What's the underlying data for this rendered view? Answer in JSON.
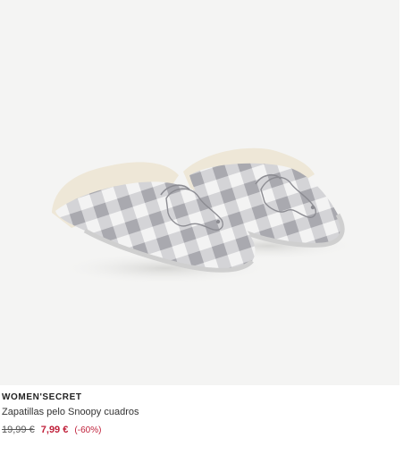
{
  "product": {
    "image_alt": "Zapatillas pelo Snoopy cuadros",
    "brand": "WOMEN'SECRET",
    "title": "Zapatillas pelo Snoopy cuadros",
    "old_price": "19,99 €",
    "new_price": "7,99 €",
    "discount": "(-60%)"
  },
  "colors": {
    "background": "#ffffff",
    "photo_background": "#f4f4f3",
    "sale_red": "#c0213b",
    "check_grey": "#b9b9be",
    "fur": "#eee7d7"
  }
}
